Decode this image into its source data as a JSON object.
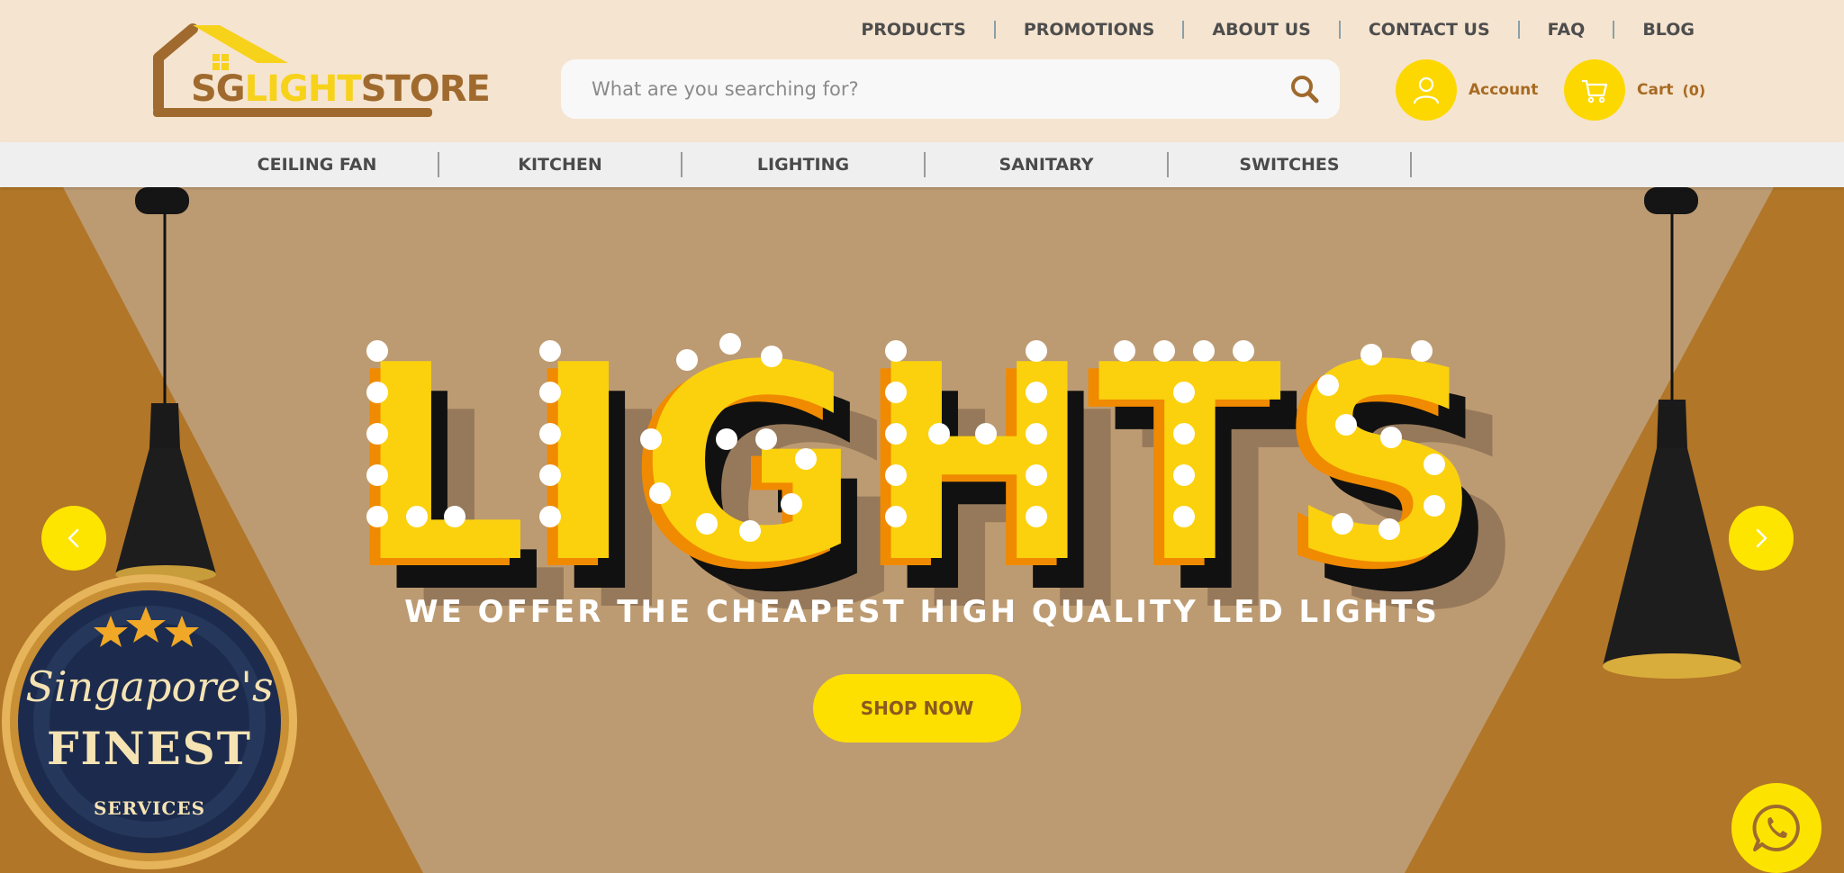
{
  "brand": {
    "logo_sg": "SG",
    "logo_light": "LIGHT",
    "logo_store": "STORE"
  },
  "top_nav": [
    {
      "label": "PRODUCTS"
    },
    {
      "label": "PROMOTIONS"
    },
    {
      "label": "ABOUT US"
    },
    {
      "label": "CONTACT US"
    },
    {
      "label": "FAQ"
    },
    {
      "label": "BLOG"
    }
  ],
  "search": {
    "placeholder": "What are you searching for?",
    "value": ""
  },
  "account": {
    "label": "Account",
    "icon": "user-icon"
  },
  "cart": {
    "label": "Cart",
    "count": "(0)",
    "icon": "cart-icon"
  },
  "categories": [
    {
      "label": "CEILING FAN"
    },
    {
      "label": "KITCHEN"
    },
    {
      "label": "LIGHTING"
    },
    {
      "label": "SANITARY"
    },
    {
      "label": "SWITCHES"
    }
  ],
  "hero": {
    "headline": "LIGHTS",
    "tagline": "WE OFFER THE CHEAPEST HIGH QUALITY LED LIGHTS",
    "cta_label": "SHOP NOW",
    "prev_icon": "chevron-left-icon",
    "next_icon": "chevron-right-icon"
  },
  "badge": {
    "line1": "Singapore's",
    "line2": "FINEST",
    "line3": "SERVICES"
  },
  "whatsapp": {
    "icon": "whatsapp-icon"
  },
  "colors": {
    "header_bg": "#f5e4cf",
    "accent_yellow": "#fdd800",
    "brand_brown": "#a06a2e",
    "hero_bg": "#b17628",
    "hero_light": "#bd9b72"
  }
}
